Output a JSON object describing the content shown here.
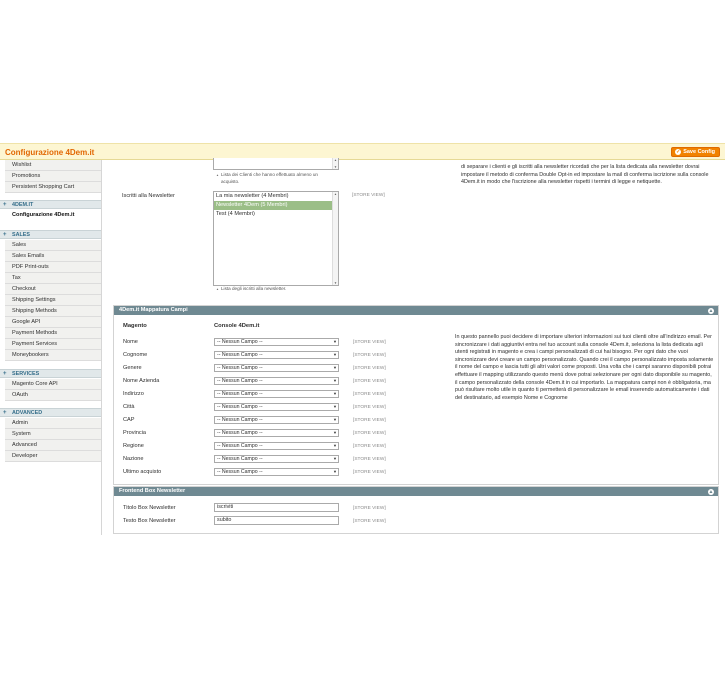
{
  "header": {
    "title": "Configurazione 4Dem.it",
    "save_label": "Save Config"
  },
  "sidebar": {
    "customers_items": [
      "Wishlist",
      "Promotions",
      "Persistent Shopping Cart"
    ],
    "group_4dem": "4DEM.IT",
    "group_4dem_items": [
      "Configurazione 4Dem.it"
    ],
    "group_sales": "SALES",
    "group_sales_items": [
      "Sales",
      "Sales Emails",
      "PDF Print-outs",
      "Tax",
      "Checkout",
      "Shipping Settings",
      "Shipping Methods",
      "Google API",
      "Payment Methods",
      "Payment Services",
      "Moneybookers"
    ],
    "group_services": "SERVICES",
    "group_services_items": [
      "Magento Core API",
      "OAuth"
    ],
    "group_advanced": "ADVANCED",
    "group_advanced_items": [
      "Admin",
      "System",
      "Advanced",
      "Developer"
    ]
  },
  "top_section": {
    "clients_note": "Lista dei Clienti che hanno effettuato almeno un acquisto.",
    "subscribers_label": "Iscritti alla Newsletter",
    "subscribers_scope": "[STORE VIEW]",
    "subscribers_options": [
      "La mia newsletter (4 Membri)",
      "Newsletter 4Dem (5 Membri)",
      "Test (4 Membri)"
    ],
    "subscribers_selected": "Newsletter 4Dem (5 Membri)",
    "subscribers_note": "Lista degli iscritti alla newsletter.",
    "right_text": "di separare i clienti e gli iscritti alla newsletter ricordati che per la lista dedicata alla newsletter dovrai impostare il metodo di conferma Double Opt-in ed impostare la mail di conferma iscrizione sulla console 4Dem.it in modo che l'iscrizione alla newsletter rispetti i termini di legge e netiquette."
  },
  "mapping_section": {
    "title": "4Dem.it Mappatura Campi",
    "col_magento": "Magento",
    "col_console": "Console 4Dem.it",
    "rows": [
      {
        "label": "Nome",
        "value": "-- Nessun Campo --",
        "scope": "[STORE VIEW]"
      },
      {
        "label": "Cognome",
        "value": "-- Nessun Campo --",
        "scope": "[STORE VIEW]"
      },
      {
        "label": "Genere",
        "value": "-- Nessun Campo --",
        "scope": "[STORE VIEW]"
      },
      {
        "label": "Nome Azienda",
        "value": "-- Nessun Campo --",
        "scope": "[STORE VIEW]"
      },
      {
        "label": "Indirizzo",
        "value": "-- Nessun Campo --",
        "scope": "[STORE VIEW]"
      },
      {
        "label": "Città",
        "value": "-- Nessun Campo --",
        "scope": "[STORE VIEW]"
      },
      {
        "label": "CAP",
        "value": "-- Nessun Campo --",
        "scope": "[STORE VIEW]"
      },
      {
        "label": "Provincia",
        "value": "-- Nessun Campo --",
        "scope": "[STORE VIEW]"
      },
      {
        "label": "Regione",
        "value": "-- Nessun Campo --",
        "scope": "[STORE VIEW]"
      },
      {
        "label": "Nazione",
        "value": "-- Nessun Campo --",
        "scope": "[STORE VIEW]"
      },
      {
        "label": "Ultimo acquisto",
        "value": "-- Nessun Campo --",
        "scope": "[STORE VIEW]"
      }
    ],
    "description": "In questo pannello puoi decidere di importare ulteriori informazioni sui tuoi clienti oltre all'indirizzo email. Per sincronizzare i dati aggiuntivi entra nel tuo account sulla console 4Dem.it, seleziona la lista dedicata agli utenti registrati in magento e crea i campi personalizzati di cui hai bisogno. Per ogni dato che vuoi sincronizzare devi creare un campo personalizzato. Quando crei il campo personalizzato imposta solamente il nome del campo e lascia tutti gli altri valori come proposti. Una volta che i campi saranno disponibili potrai effettuare il mapping utilizzando questo menù dove potrai selezionare per ogni dato disponibile su magento, il campo personalizzato della console 4Dem.it in cui importarlo. La mappatura campi non è obbligatoria, ma può risultare molto utile in quanto ti permetterà di personalizzare le email inserendo automaticamente i dati del destinatario, ad esempio Nome e Cognome"
  },
  "frontend_section": {
    "title": "Frontend Box Newsletter",
    "rows": [
      {
        "label": "Titolo Box Newsletter",
        "value": "iscriviti",
        "scope": "[STORE VIEW]"
      },
      {
        "label": "Testo Box Newsletter",
        "value": "subito",
        "scope": "[STORE VIEW]"
      }
    ]
  }
}
